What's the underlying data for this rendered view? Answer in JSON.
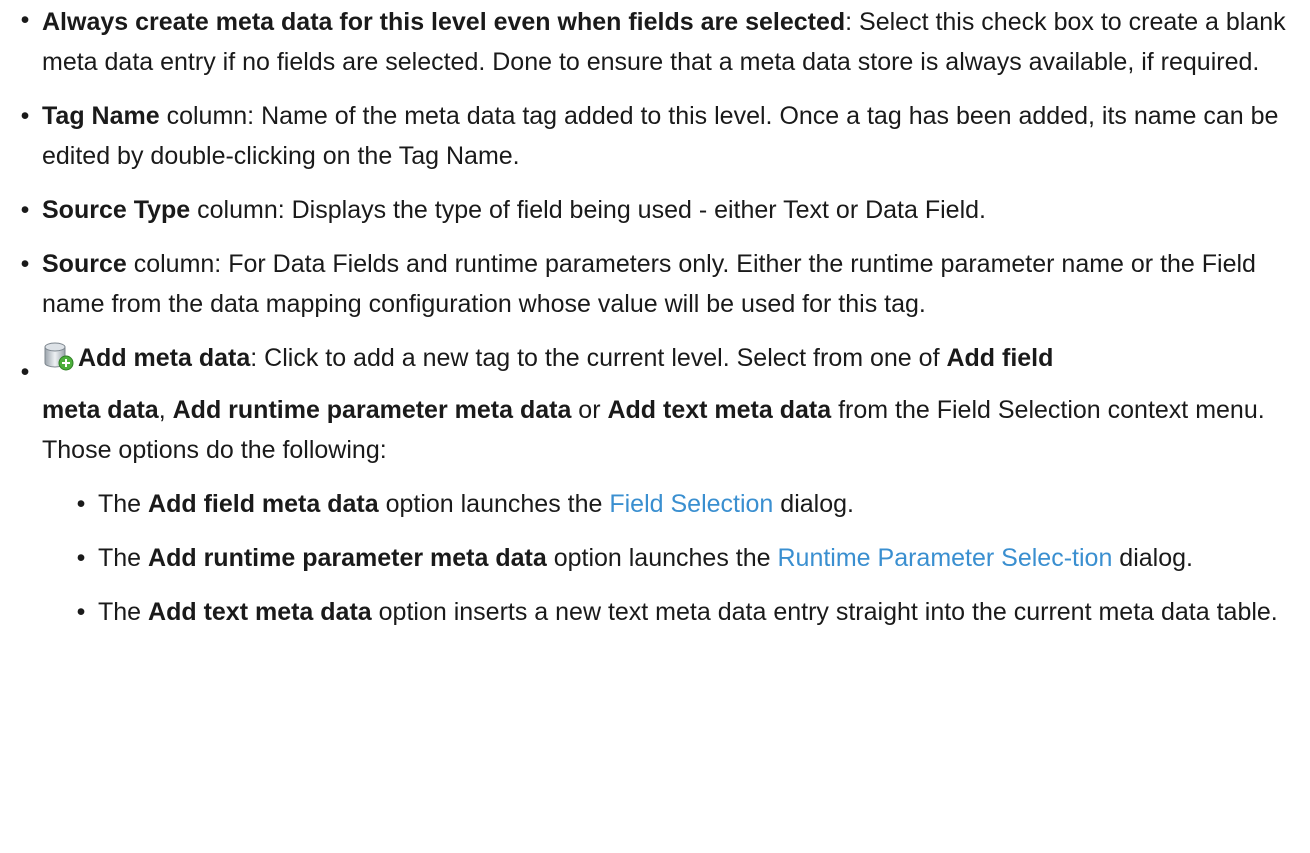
{
  "items": [
    {
      "bold": "Always create meta data for this level even when fields are selected",
      "text": ": Select this check box to create a blank meta data entry if no fields are selected. Done to ensure that a meta data store is always available, if required."
    },
    {
      "bold": "Tag Name",
      "text": " column: Name of the meta data tag added to this level. Once a tag has been added, its name can be edited by double-clicking on the Tag Name."
    },
    {
      "bold": "Source Type",
      "text": " column: Displays the type of field being used - either Text or Data Field."
    },
    {
      "bold": "Source",
      "text": " column: For Data Fields and runtime parameters only. Either the runtime parameter name or the Field name from the data mapping configuration whose value will be used for this tag."
    }
  ],
  "add_meta": {
    "icon": "database-add-icon",
    "bold": "Add meta data",
    "text1": ": Click to add a new tag to the current level. Select from one of ",
    "bold2": "Add field",
    "bold3": "meta data",
    "sep1": ", ",
    "bold4": "Add runtime parameter meta data",
    "sep2": " or ",
    "bold5": "Add text meta data",
    "text2": " from the Field Selection context menu. Those options do the following:"
  },
  "sub_items": [
    {
      "pre": "The ",
      "bold": "Add field meta data",
      "mid": " option launches the ",
      "link": "Field Selection",
      "post": " dialog."
    },
    {
      "pre": "The ",
      "bold": "Add runtime parameter meta data",
      "mid": " option launches the ",
      "link": "Runtime Parameter Selec-tion",
      "post": " dialog."
    },
    {
      "pre": "The ",
      "bold": "Add text meta data",
      "mid": " option inserts a new text meta data entry straight into the current meta data table.",
      "link": "",
      "post": ""
    }
  ],
  "colors": {
    "link": "#3a8fd0",
    "text": "#1a1a1a"
  }
}
